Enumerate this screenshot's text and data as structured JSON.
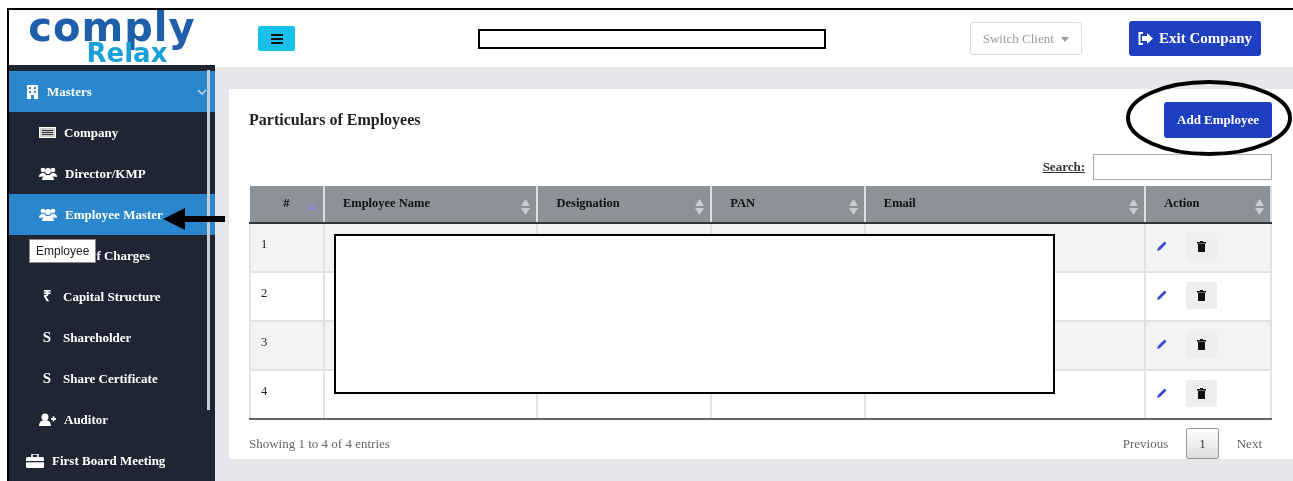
{
  "logo": {
    "line1": "comply",
    "line2": "Relax"
  },
  "sidebar": {
    "items": [
      {
        "label": "Masters",
        "selected": true,
        "expanded": true,
        "children": [
          {
            "label": "Company",
            "selected": false
          },
          {
            "label": "Director/KMP",
            "selected": false
          },
          {
            "label": "Employee Master",
            "selected": true
          },
          {
            "label": "f Charges",
            "selected": false,
            "tooltip": "Employee"
          },
          {
            "label": "Capital Structure",
            "selected": false,
            "glyph": "₹"
          },
          {
            "label": "Shareholder",
            "selected": false,
            "glyph": "S"
          },
          {
            "label": "Share Certificate",
            "selected": false,
            "glyph": "S"
          },
          {
            "label": "Auditor",
            "selected": false
          }
        ]
      },
      {
        "label": "First Board Meeting",
        "selected": false
      }
    ]
  },
  "topbar": {
    "switch_client": {
      "label": "Switch Client",
      "disabled": true
    },
    "exit_button": "Exit Company"
  },
  "card": {
    "title": "Particulars of Employees",
    "add_button": "Add Employee",
    "search_label": "Search:",
    "table": {
      "columns": [
        {
          "label": "#",
          "sorted": true
        },
        {
          "label": "Employee Name",
          "sorted": false
        },
        {
          "label": "Designation",
          "sorted": false
        },
        {
          "label": "PAN",
          "sorted": false
        },
        {
          "label": "Email",
          "sorted": false
        },
        {
          "label": "Action",
          "sorted": false
        }
      ],
      "rows": [
        {
          "number": "1"
        },
        {
          "number": "2"
        },
        {
          "number": "3"
        },
        {
          "number": "4"
        }
      ]
    },
    "info": "Showing 1 to 4 of 4 entries",
    "pagination": [
      {
        "label": "Previous",
        "kind": "link",
        "selected": false
      },
      {
        "label": "1",
        "kind": "page",
        "selected": true
      },
      {
        "label": "Next",
        "kind": "link",
        "selected": false
      }
    ]
  }
}
